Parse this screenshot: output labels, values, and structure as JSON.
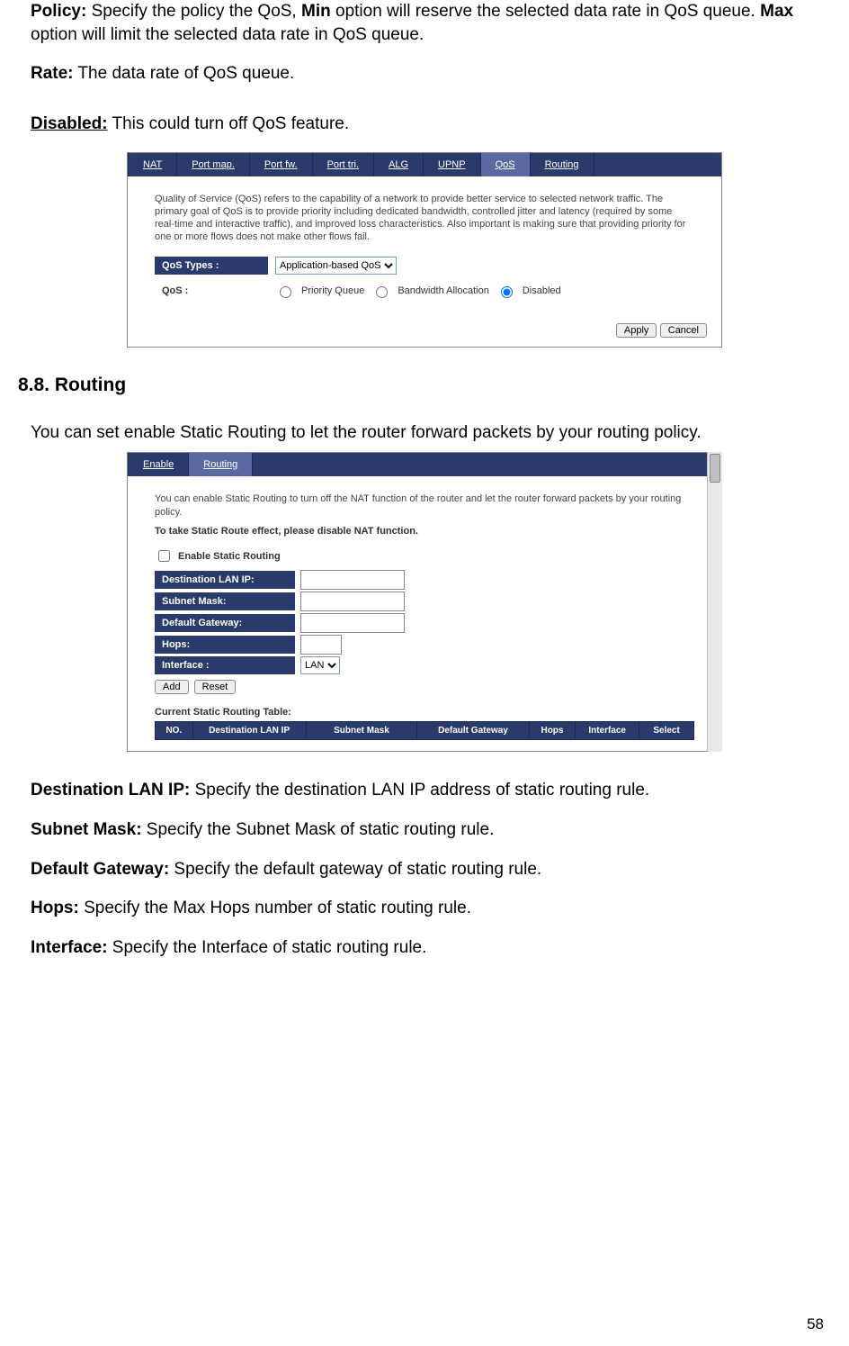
{
  "top": {
    "policy_label": "Policy:",
    "policy_text1": " Specify the policy the QoS, ",
    "policy_min": "Min",
    "policy_text2": " option will reserve the selected data rate in QoS queue. ",
    "policy_max": "Max",
    "policy_text3": " option will limit the selected data rate in QoS queue.",
    "rate_label": "Rate:",
    "rate_text": " The data rate of QoS queue.",
    "disabled_label": "Disabled:",
    "disabled_text": "  This could turn off QoS feature."
  },
  "panel1": {
    "tabs": [
      "NAT",
      "Port map.",
      "Port fw.",
      "Port tri.",
      "ALG",
      "UPNP",
      "QoS",
      "Routing"
    ],
    "active_tab": "QoS",
    "desc": "Quality of Service (QoS) refers to the capability of a network to provide better service to selected network traffic. The primary goal of QoS is to provide priority including dedicated bandwidth, controlled jitter and latency (required by some real-time and interactive traffic), and improved loss characteristics. Also important is making sure that providing priority for one or more flows does not make other flows fail.",
    "types_label": "QoS Types :",
    "types_value": "Application-based QoS",
    "qos_label": "QoS :",
    "radios": [
      "Priority Queue",
      "Bandwidth Allocation",
      "Disabled"
    ],
    "radio_selected": "Disabled",
    "apply": "Apply",
    "cancel": "Cancel"
  },
  "section": {
    "heading": "8.8. Routing",
    "intro": "You can set enable Static Routing to let the router forward packets by your routing policy."
  },
  "panel2": {
    "tabs": [
      "Enable",
      "Routing"
    ],
    "active_tab": "Routing",
    "desc": "You can enable Static Routing to turn off the NAT function of the router and let the router forward packets by your routing policy.",
    "warn": "To take Static Route effect, please disable NAT function.",
    "enable_label": "Enable Static Routing",
    "fields": {
      "dest": "Destination LAN IP:",
      "mask": "Subnet Mask:",
      "gw": "Default Gateway:",
      "hops": "Hops:",
      "iface": "Interface :",
      "iface_value": "LAN"
    },
    "add": "Add",
    "reset": "Reset",
    "table_title": "Current Static Routing Table:",
    "columns": [
      "NO.",
      "Destination LAN IP",
      "Subnet Mask",
      "Default Gateway",
      "Hops",
      "Interface",
      "Select"
    ]
  },
  "defs": {
    "dest_l": "Destination LAN IP:",
    "dest_t": " Specify the destination LAN IP address of static routing rule.",
    "mask_l": "Subnet Mask:",
    "mask_t": " Specify the Subnet Mask of static routing rule.",
    "gw_l": "Default Gateway:",
    "gw_t": " Specify the default gateway of static routing rule.",
    "hops_l": "Hops:",
    "hops_t": " Specify the Max Hops number of static routing rule.",
    "iface_l": "Interface:",
    "iface_t": " Specify the Interface of static routing rule."
  },
  "page_number": "58"
}
